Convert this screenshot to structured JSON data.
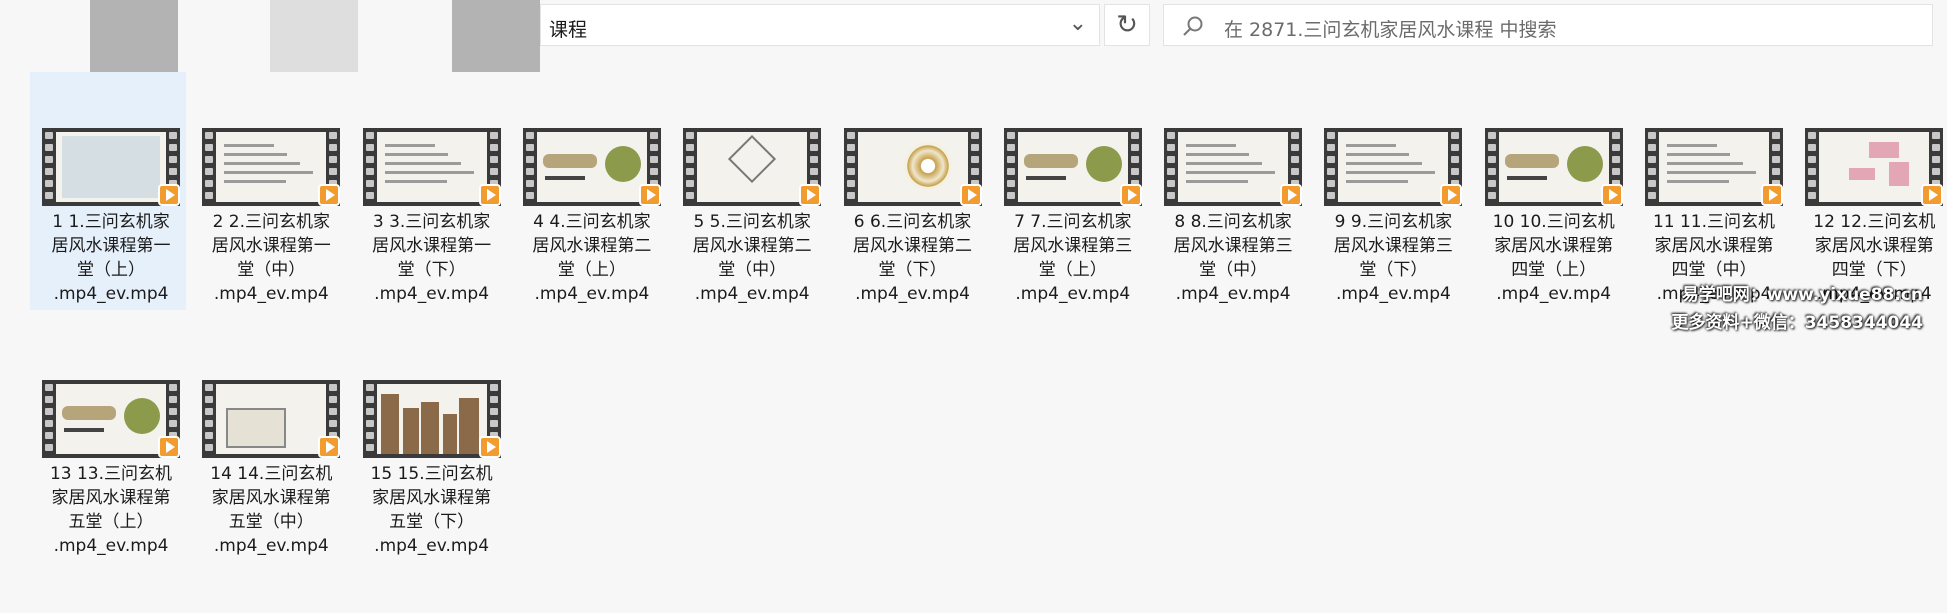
{
  "address_bar": {
    "path_text": "课程"
  },
  "search": {
    "placeholder": "在 2871.三问玄机家居风水课程 中搜索"
  },
  "files": [
    {
      "name_line1": "1 1.三问玄机家",
      "name_line2": "居风水课程第一",
      "name_line3": "堂（上）",
      "name_line4": ".mp4_ev.mp4",
      "selected": true
    },
    {
      "name_line1": "2 2.三问玄机家",
      "name_line2": "居风水课程第一",
      "name_line3": "堂（中）",
      "name_line4": ".mp4_ev.mp4"
    },
    {
      "name_line1": "3 3.三问玄机家",
      "name_line2": "居风水课程第一",
      "name_line3": "堂（下）",
      "name_line4": ".mp4_ev.mp4"
    },
    {
      "name_line1": "4 4.三问玄机家",
      "name_line2": "居风水课程第二",
      "name_line3": "堂（上）",
      "name_line4": ".mp4_ev.mp4"
    },
    {
      "name_line1": "5 5.三问玄机家",
      "name_line2": "居风水课程第二",
      "name_line3": "堂（中）",
      "name_line4": ".mp4_ev.mp4"
    },
    {
      "name_line1": "6 6.三问玄机家",
      "name_line2": "居风水课程第二",
      "name_line3": "堂（下）",
      "name_line4": ".mp4_ev.mp4"
    },
    {
      "name_line1": "7 7.三问玄机家",
      "name_line2": "居风水课程第三",
      "name_line3": "堂（上）",
      "name_line4": ".mp4_ev.mp4"
    },
    {
      "name_line1": "8 8.三问玄机家",
      "name_line2": "居风水课程第三",
      "name_line3": "堂（中）",
      "name_line4": ".mp4_ev.mp4"
    },
    {
      "name_line1": "9 9.三问玄机家",
      "name_line2": "居风水课程第三",
      "name_line3": "堂（下）",
      "name_line4": ".mp4_ev.mp4"
    },
    {
      "name_line1": "10 10.三问玄机",
      "name_line2": "家居风水课程第",
      "name_line3": "四堂（上）",
      "name_line4": ".mp4_ev.mp4"
    },
    {
      "name_line1": "11 11.三问玄机",
      "name_line2": "家居风水课程第",
      "name_line3": "四堂（中）",
      "name_line4": ".mp4_ev.mp4"
    },
    {
      "name_line1": "12 12.三问玄机",
      "name_line2": "家居风水课程第",
      "name_line3": "四堂（下）",
      "name_line4": ".mp4_ev.mp4"
    },
    {
      "name_line1": "13 13.三问玄机",
      "name_line2": "家居风水课程第",
      "name_line3": "五堂（上）",
      "name_line4": ".mp4_ev.mp4"
    },
    {
      "name_line1": "14 14.三问玄机",
      "name_line2": "家居风水课程第",
      "name_line3": "五堂（中）",
      "name_line4": ".mp4_ev.mp4"
    },
    {
      "name_line1": "15 15.三问玄机",
      "name_line2": "家居风水课程第",
      "name_line3": "五堂（下）",
      "name_line4": ".mp4_ev.mp4"
    }
  ],
  "watermark": {
    "line1": "易学吧网：www.yixue88.cn",
    "line2": "更多资料+微信：3458344044"
  }
}
